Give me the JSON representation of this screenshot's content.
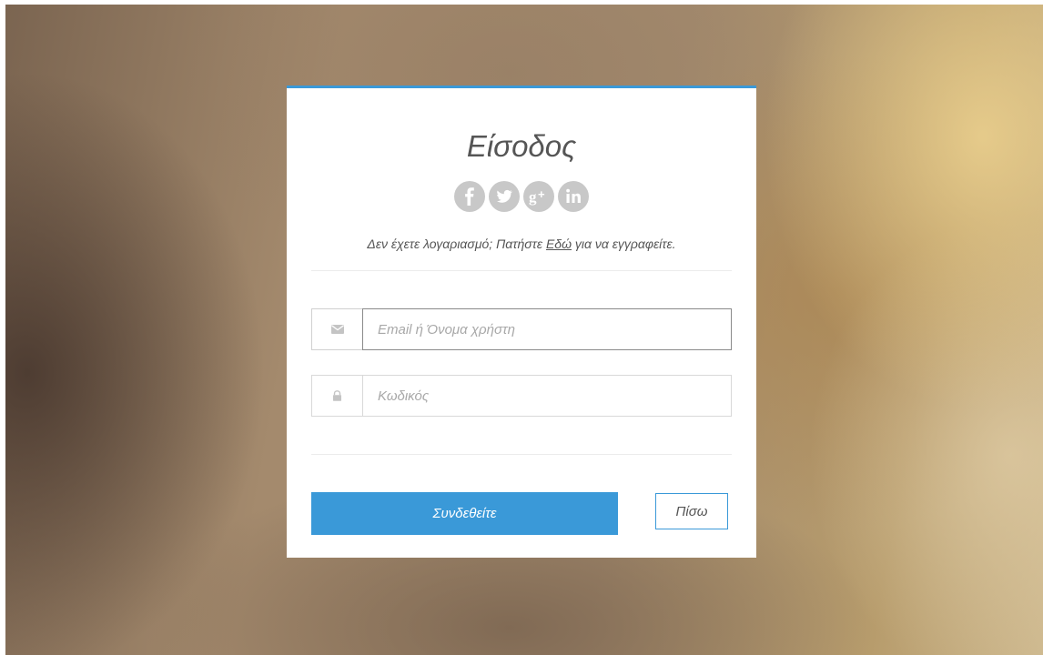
{
  "login": {
    "title": "Είσοδος",
    "social": [
      {
        "name": "facebook",
        "icon": "facebook-icon"
      },
      {
        "name": "twitter",
        "icon": "twitter-icon"
      },
      {
        "name": "google-plus",
        "icon": "google-plus-icon"
      },
      {
        "name": "linkedin",
        "icon": "linkedin-icon"
      }
    ],
    "signup_prefix": "Δεν έχετε λογαριασμό; Πατήστε ",
    "signup_link": "Εδώ",
    "signup_suffix": " για να εγγραφείτε.",
    "email": {
      "icon": "envelope-icon",
      "placeholder": "Email ή Όνομα χρήστη",
      "value": ""
    },
    "password": {
      "icon": "lock-icon",
      "placeholder": "Κωδικός",
      "value": ""
    },
    "submit_label": "Συνδεθείτε",
    "back_label": "Πίσω"
  },
  "colors": {
    "accent": "#3a99d8",
    "social_icon": "#c8c8c8",
    "text": "#555555",
    "placeholder": "#a8a8a8"
  }
}
